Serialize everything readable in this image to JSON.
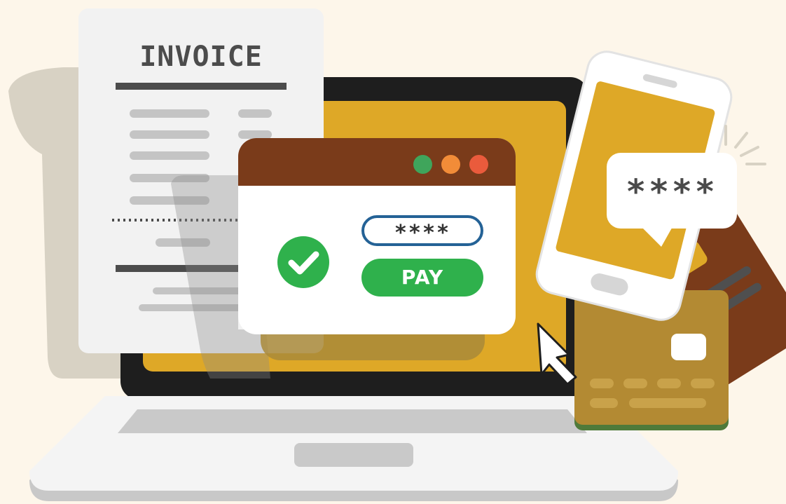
{
  "scene": {
    "background": "#fdf6ea",
    "accent_gold": "#dea827",
    "accent_green": "#2fb14c",
    "accent_brown": "#7a3b1a"
  },
  "invoice": {
    "title": "INVOICE"
  },
  "payment_window": {
    "window_dots": [
      "green",
      "orange",
      "red"
    ],
    "password_field_value": "****",
    "pay_label": "PAY",
    "status_icon": "check-circle-icon"
  },
  "phone": {
    "message_bubble": "****"
  },
  "icons": [
    "invoice-document-icon",
    "laptop-icon",
    "browser-window-icon",
    "check-circle-icon",
    "smartphone-icon",
    "speech-bubble-icon",
    "credit-card-icon",
    "mouse-cursor-icon"
  ]
}
